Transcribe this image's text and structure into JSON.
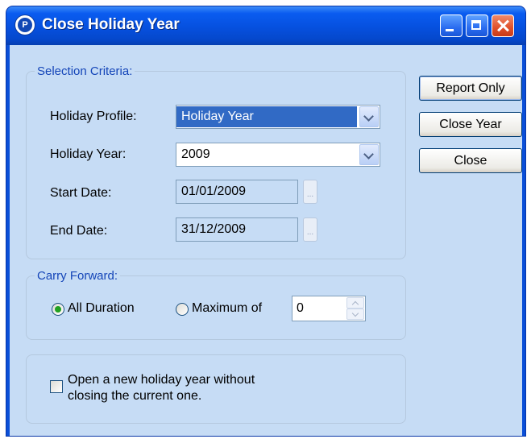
{
  "window": {
    "title": "Close Holiday Year",
    "icon": "app-logo-icon",
    "icon_glyph": "P"
  },
  "selection_criteria": {
    "legend": "Selection Criteria:",
    "holiday_profile": {
      "label": "Holiday Profile:",
      "value": "Holiday Year"
    },
    "holiday_year": {
      "label": "Holiday Year:",
      "value": "2009"
    },
    "start_date": {
      "label": "Start Date:",
      "value": "01/01/2009",
      "ellipsis": "..."
    },
    "end_date": {
      "label": "End Date:",
      "value": "31/12/2009",
      "ellipsis": "..."
    }
  },
  "carry_forward": {
    "legend": "Carry Forward:",
    "all_duration": {
      "label": "All Duration",
      "selected": true
    },
    "maximum_of": {
      "label": "Maximum of",
      "selected": false,
      "value": "0"
    }
  },
  "options": {
    "open_new_year": {
      "line1": "Open a new holiday year without",
      "line2": "closing the current one.",
      "checked": false
    }
  },
  "buttons": {
    "report_only": "Report Only",
    "close_year": "Close Year",
    "close": "Close"
  },
  "colors": {
    "titlebar": "#0650de",
    "dialog_background": "#c6dcf5",
    "legend_text": "#1445b8",
    "selection_highlight": "#316ac5",
    "radio_dot": "#21a121"
  }
}
